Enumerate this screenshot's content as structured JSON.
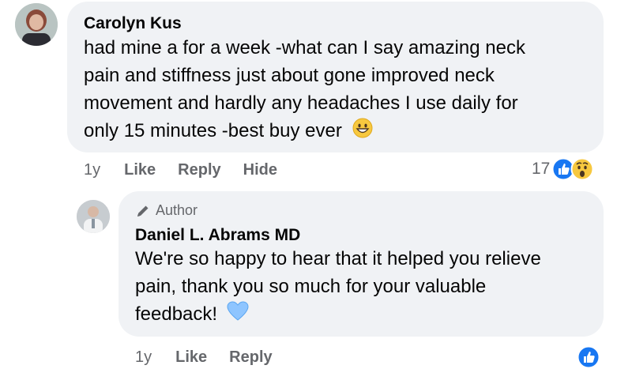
{
  "comment": {
    "author": "Carolyn Kus",
    "text_lines": [
      "had mine a for a week -what can I say amazing neck",
      "pain and stiffness just about gone improved neck",
      "movement and hardly any headaches I use daily for",
      "only 15 minutes -best buy ever"
    ],
    "emoji": "grinning-face-emoji",
    "time": "1y",
    "like_label": "Like",
    "reply_label": "Reply",
    "hide_label": "Hide",
    "reaction_count": "17",
    "reactions": [
      "like-icon",
      "wow-icon"
    ]
  },
  "reply": {
    "badge_icon": "pen-icon",
    "badge_label": "Author",
    "author": "Daniel L. Abrams MD",
    "text_lines": [
      "We're so happy to hear that it helped you relieve",
      "pain, thank you so much for your valuable",
      "feedback!"
    ],
    "emoji": "blue-heart-emoji",
    "time": "1y",
    "like_label": "Like",
    "reply_label": "Reply",
    "reactions": [
      "like-icon"
    ]
  },
  "colors": {
    "bubble": "#f0f2f5",
    "secondary_text": "#65676b",
    "like_blue": "#1877f2",
    "heart_blue": "#8ec5ff"
  }
}
